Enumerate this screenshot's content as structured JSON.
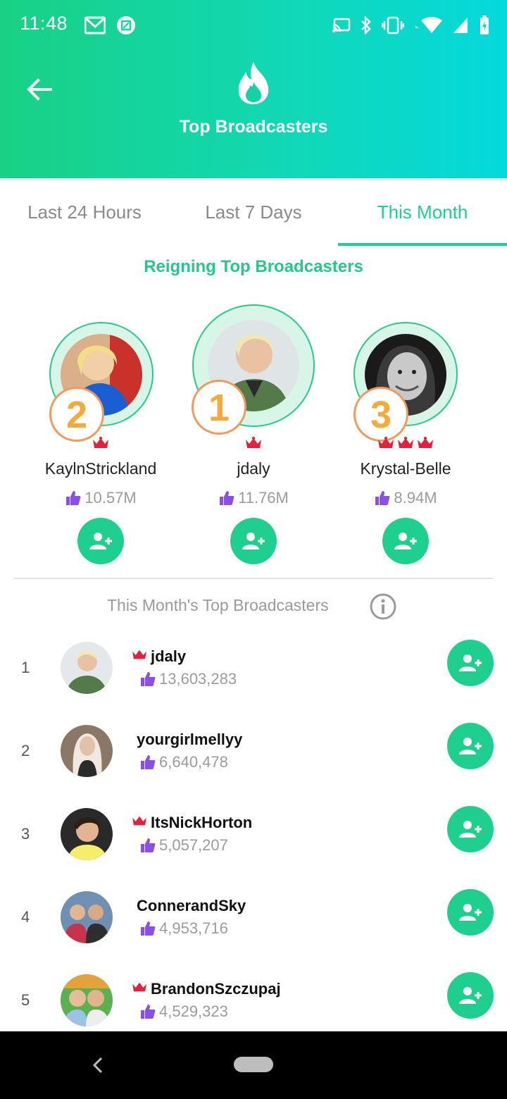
{
  "status_bar": {
    "time": "11:48",
    "left_icons": [
      "gmail-icon",
      "screenshot-icon"
    ],
    "right_icons": [
      "cast-icon",
      "bluetooth-icon",
      "vibrate-icon",
      "wifi-icon",
      "signal-icon",
      "battery-charging-icon"
    ]
  },
  "header": {
    "title": "Top Broadcasters",
    "icon": "flame-icon",
    "back_icon": "arrow-left-icon"
  },
  "tabs": [
    {
      "label": "Last 24 Hours",
      "active": false
    },
    {
      "label": "Last 7 Days",
      "active": false
    },
    {
      "label": "This Month",
      "active": true
    }
  ],
  "reigning": {
    "title": "Reigning Top Broadcasters",
    "entries": [
      {
        "rank": "2",
        "name": "KaylnStrickland",
        "likes": "10.57M",
        "crowns": 1
      },
      {
        "rank": "1",
        "name": "jdaly",
        "likes": "11.76M",
        "crowns": 1
      },
      {
        "rank": "3",
        "name": "Krystal-Belle",
        "likes": "8.94M",
        "crowns": 3
      }
    ]
  },
  "list": {
    "title": "This Month's Top Broadcasters",
    "rows": [
      {
        "rank": "1",
        "name": "jdaly",
        "likes": "13,603,283",
        "crown": true
      },
      {
        "rank": "2",
        "name": "yourgirlmellyy",
        "likes": "6,640,478",
        "crown": false
      },
      {
        "rank": "3",
        "name": "ItsNickHorton",
        "likes": "5,057,207",
        "crown": true
      },
      {
        "rank": "4",
        "name": "ConnerandSky",
        "likes": "4,953,716",
        "crown": false
      },
      {
        "rank": "5",
        "name": "BrandonSzczupaj",
        "likes": "4,529,323",
        "crown": true
      }
    ]
  },
  "colors": {
    "accent": "#1fcf8f",
    "header_gradient_start": "#19d184",
    "header_gradient_end": "#04d9dc",
    "likes_icon": "#8a4fe6",
    "crown": "#e3213b",
    "rank_badge": "#f7a93a"
  }
}
